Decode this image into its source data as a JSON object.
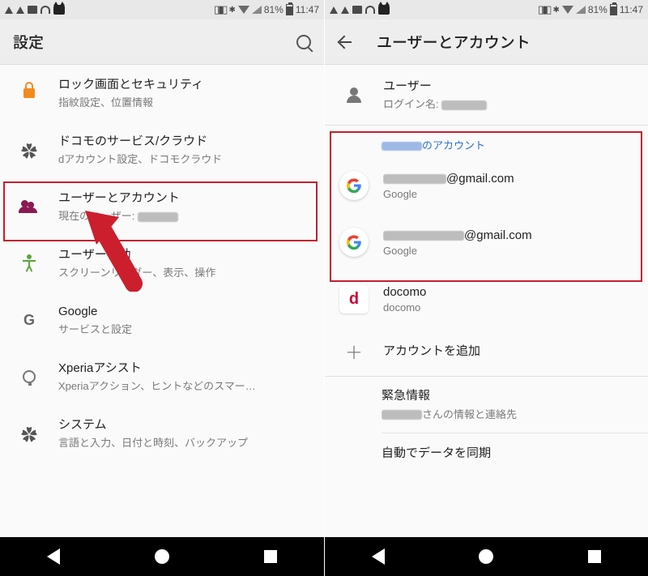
{
  "status": {
    "battery_pct": "81%",
    "time": "11:47"
  },
  "left": {
    "header_title": "設定",
    "items": [
      {
        "title": "ロック画面とセキュリティ",
        "sub": "指紋設定、位置情報"
      },
      {
        "title": "ドコモのサービス/クラウド",
        "sub": "dアカウント設定、ドコモクラウド"
      },
      {
        "title": "ユーザーとアカウント",
        "sub_prefix": "現在のユーザー: "
      },
      {
        "title": "ユーザー補助",
        "sub": "スクリーンリーダー、表示、操作"
      },
      {
        "title": "Google",
        "sub": "サービスと設定"
      },
      {
        "title": "Xperiaアシスト",
        "sub": "Xperiaアクション、ヒントなどのスマー…"
      },
      {
        "title": "システム",
        "sub": "言語と入力、日付と時刻、バックアップ"
      }
    ]
  },
  "right": {
    "header_title": "ユーザーとアカウント",
    "user": {
      "title": "ユーザー",
      "sub_prefix": "ログイン名: "
    },
    "section_label_suffix": "のアカウント",
    "accounts": [
      {
        "suffix": "@gmail.com",
        "provider": "Google"
      },
      {
        "suffix": "@gmail.com",
        "provider": "Google"
      }
    ],
    "docomo": {
      "title": "docomo",
      "sub": "docomo"
    },
    "add_account": "アカウントを追加",
    "emergency": {
      "title": "緊急情報",
      "sub_suffix": "さんの情報と連絡先"
    },
    "autosync": "自動でデータを同期"
  }
}
